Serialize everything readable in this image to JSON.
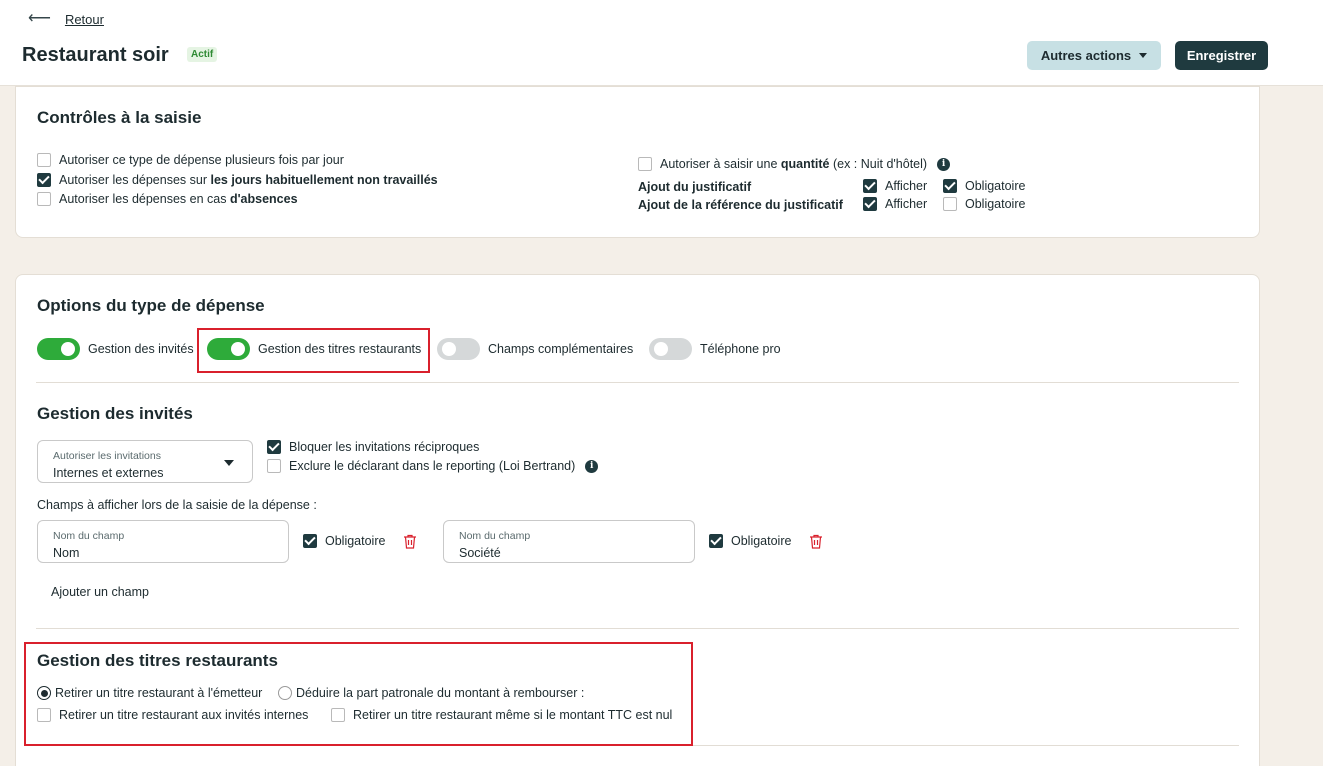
{
  "header": {
    "back_label": "Retour",
    "title": "Restaurant soir",
    "status_badge": "Actif",
    "other_actions_label": "Autres actions",
    "save_label": "Enregistrer"
  },
  "controls": {
    "title": "Contrôles à la saisie",
    "left_options": [
      {
        "text_plain": "Autoriser ce type de dépense plusieurs fois par jour",
        "text_bold": "",
        "checked": false
      },
      {
        "text_plain": "Autoriser les dépenses sur ",
        "text_bold": "les jours habituellement non travaillés",
        "checked": true
      },
      {
        "text_plain": "Autoriser les dépenses en cas ",
        "text_bold": "d'absences",
        "checked": false
      }
    ],
    "quantity": {
      "before": "Autoriser à saisir une ",
      "bold": "quantité",
      "after": " (ex : Nuit d'hôtel)",
      "checked": false
    },
    "justif_rows": [
      {
        "label": "Ajout du justificatif",
        "show_label": "Afficher",
        "show_checked": true,
        "required_label": "Obligatoire",
        "required_checked": true
      },
      {
        "label": "Ajout de la référence du justificatif",
        "show_label": "Afficher",
        "show_checked": true,
        "required_label": "Obligatoire",
        "required_checked": false
      }
    ]
  },
  "options": {
    "title": "Options du type de dépense",
    "toggles": [
      {
        "label": "Gestion des invités",
        "on": true
      },
      {
        "label": "Gestion des titres restaurants",
        "on": true
      },
      {
        "label": "Champs complémentaires",
        "on": false
      },
      {
        "label": "Téléphone pro",
        "on": false
      }
    ]
  },
  "guests": {
    "title": "Gestion des invités",
    "invitations_select": {
      "label": "Autoriser les invitations",
      "value": "Internes et externes"
    },
    "block_reciprocal": {
      "label": "Bloquer les invitations réciproques",
      "checked": true
    },
    "exclude_declarant": {
      "label": "Exclure le déclarant dans le reporting (Loi Bertrand)",
      "checked": false
    },
    "fields_caption": "Champs à afficher lors de la saisie de la dépense :",
    "fields": [
      {
        "label": "Nom du champ",
        "value": "Nom",
        "required_label": "Obligatoire",
        "required": true
      },
      {
        "label": "Nom du champ",
        "value": "Société",
        "required_label": "Obligatoire",
        "required": true
      }
    ],
    "add_field_label": "Ajouter un champ"
  },
  "meal_vouchers": {
    "title": "Gestion des titres restaurants",
    "radio_withdraw": {
      "label": "Retirer un titre restaurant à l'émetteur",
      "selected": true
    },
    "radio_deduct": {
      "label": "Déduire la part patronale du montant à rembourser :",
      "selected": false
    },
    "internal_guests": {
      "label": "Retirer un titre restaurant aux invités internes",
      "checked": false
    },
    "zero_amount": {
      "label": "Retirer un titre restaurant même si le montant TTC est nul",
      "checked": false
    }
  },
  "colors": {
    "primary": "#1f3a3f",
    "toggle_on": "#2eab3a",
    "highlight": "#d9202c",
    "background": "#f4efe8"
  }
}
